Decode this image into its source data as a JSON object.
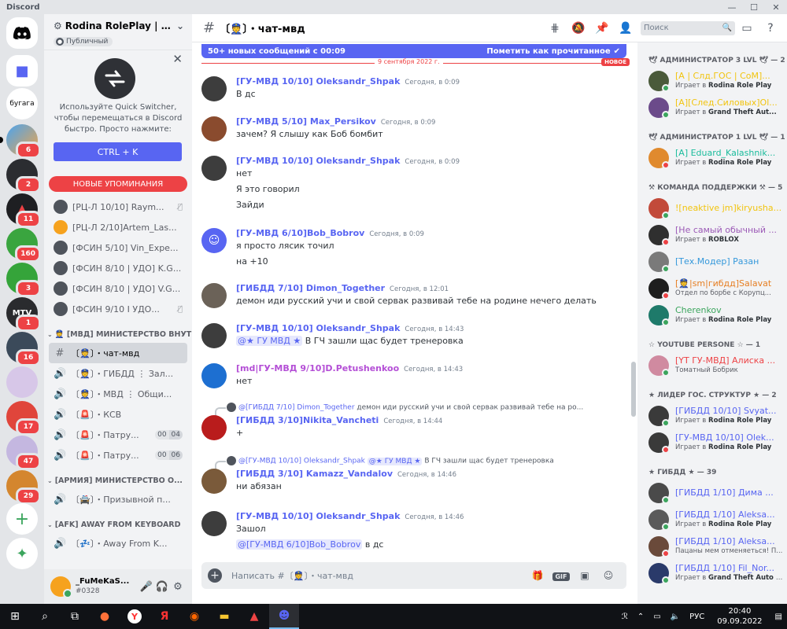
{
  "app": {
    "title": "Discord"
  },
  "colors": {
    "blurple": "#5865f2",
    "red": "#ed4245",
    "green": "#3ba55d"
  },
  "rail": {
    "servers": [
      {
        "name": "home",
        "label": ""
      },
      {
        "name": "folder",
        "label": ""
      },
      {
        "name": "bugaga",
        "label": "бугага"
      },
      {
        "name": "server-3",
        "badge": "6"
      },
      {
        "name": "server-4",
        "badge": "2"
      },
      {
        "name": "server-5",
        "badge": "11"
      },
      {
        "name": "server-6",
        "badge": "160"
      },
      {
        "name": "server-7",
        "badge": "3"
      },
      {
        "name": "server-8",
        "label": "MTV",
        "badge": "1"
      },
      {
        "name": "server-9",
        "badge": "16"
      },
      {
        "name": "server-10",
        "label": ""
      },
      {
        "name": "server-11",
        "badge": "17"
      },
      {
        "name": "server-12",
        "badge": "47"
      },
      {
        "name": "server-13",
        "badge": "29"
      }
    ]
  },
  "server": {
    "name": "Rodina RolePlay | Bo...",
    "public_label": "Публичный"
  },
  "quick_switcher": {
    "description": "Используйте Quick Switcher, чтобы перемещаться в Discord быстро. Просто нажмите:",
    "button": "CTRL + K"
  },
  "new_mentions": "НОВЫЕ УПОМИНАНИЯ",
  "channels": {
    "voice_users": [
      {
        "label": "[РЦ-Л 10/10] Raym..."
      },
      {
        "label": "[РЦ-Л 2/10]Artem_Las..."
      },
      {
        "label": "[ФСИН 5/10] Vin_Expe..."
      },
      {
        "label": "[ФСИН 8/10 | УДО] K.G..."
      },
      {
        "label": "[ФСИН 8/10 | УДО] V.G..."
      },
      {
        "label": "[ФСИН 9/10 I УДО..."
      }
    ],
    "category_mvd": "[МВД] МИНИСТЕРСТВО ВНУТ...",
    "mvd_channels": [
      {
        "label": "〔👮〕・чат-мвд",
        "count": []
      },
      {
        "label": "〔👮〕・ГИБДД ⋮ Зал...",
        "count": []
      },
      {
        "label": "〔👮〕・МВД ⋮ Общи...",
        "count": []
      },
      {
        "label": "〔🚨〕・КСВ",
        "count": []
      },
      {
        "label": "〔🚨〕・Патру...",
        "count": [
          "00",
          "04"
        ]
      },
      {
        "label": "〔🚨〕・Патру...",
        "count": [
          "00",
          "06"
        ]
      }
    ],
    "category_army": "[АРМИЯ] МИНИСТЕРСТВО О...",
    "army_channels": [
      {
        "label": "〔🚔〕・Призывной п..."
      }
    ],
    "category_afk": "[AFK] AWAY FROM KEYBOARD",
    "afk_channels": [
      {
        "label": "〔💤〕・Away From K..."
      }
    ]
  },
  "user": {
    "name": "_FuMeKaS...",
    "tag": "#0328"
  },
  "chat": {
    "channel_name": "〔👮〕・чат-мвд",
    "new_messages": "50+ новых сообщений с 00:09",
    "mark_read": "Пометить как прочитанное",
    "date_divider": "9 сентября 2022 г.",
    "new_badge": "НОВОЕ",
    "placeholder": "Написать #〔👮〕・чат-мвд",
    "messages": [
      {
        "author": "[ГУ-МВД 10/10] Oleksandr_Shpak",
        "time": "Сегодня, в 0:09",
        "lines": [
          "В дс"
        ]
      },
      {
        "author": "[ГУ-МВД 5/10] Max_Persikov",
        "time": "Сегодня, в 0:09",
        "lines": [
          "зачем? Я слышу как Боб бомбит"
        ]
      },
      {
        "author": "[ГУ-МВД 10/10] Oleksandr_Shpak",
        "time": "Сегодня, в 0:09",
        "lines": [
          "нет",
          "Я это говорил",
          "Зайди"
        ]
      },
      {
        "author": "[ГУ-МВД 6/10]Bob_Bobrov",
        "time": "Сегодня, в 0:09",
        "lines": [
          "я просто лясик точил",
          "на +10"
        ]
      },
      {
        "author": "[ГИБДД 7/10] Dimon_Together",
        "time": "Сегодня, в 12:01",
        "lines": [
          "демон иди русский учи и свой сервак развивай тебе на родине нечего делать"
        ]
      },
      {
        "author": "[ГУ-МВД 10/10] Oleksandr_Shpak",
        "time": "Сегодня, в 14:43",
        "mention": "@★ ГУ МВД ★",
        "lines": [
          "В ГЧ зашли щас будет тренеровка"
        ]
      },
      {
        "author": "[md|ГУ-МВД 9/10]D.Petushenkoo",
        "time": "Сегодня, в 14:43",
        "lines": [
          "нет"
        ]
      },
      {
        "reply_author": "@[ГИБДД 7/10] Dimon_Together",
        "reply_text": "демон иди русский учи и свой сервак развивай тебе на ро...",
        "author": "[ГИБДД 3/10]Nikita_Vancheti",
        "time": "Сегодня, в 14:44",
        "lines": [
          "+"
        ]
      },
      {
        "reply_author": "@[ГУ-МВД 10/10] Oleksandr_Shpak",
        "reply_mention": "@★ ГУ МВД ★",
        "reply_text": "В ГЧ зашли щас будет тренеровка",
        "author": "[ГИБДД 3/10] Kamazz_Vandalov",
        "time": "Сегодня, в 14:46",
        "lines": [
          "ни абязан"
        ]
      },
      {
        "author": "[ГУ-МВД 10/10] Oleksandr_Shpak",
        "time": "Сегодня, в 14:46",
        "lines": [
          "Зашол"
        ],
        "mention_line": "@[ГУ-МВД 6/10]Bob_Bobrov",
        "mention_tail": "в дс"
      }
    ]
  },
  "members_search": "Поиск",
  "members": {
    "groups": [
      {
        "title": "🕊 АДМИНИСТРАТОР 3 LVL 🕊 — 2",
        "items": [
          {
            "name": "[A | Слд.ГОС | СоМ]...",
            "color": "#f1c40f",
            "activity_prefix": "Играет в",
            "activity": "Rodina Role Play",
            "status": "online"
          },
          {
            "name": "[A][След.Силовых]Ol...",
            "color": "#f1c40f",
            "activity_prefix": "Играет в",
            "activity": "Grand Theft Aut...",
            "status": "online"
          }
        ]
      },
      {
        "title": "🕊 АДМИНИСТРАТОР 1 LVL 🕊 — 1",
        "items": [
          {
            "name": "[A] Eduard_Kalashnik...",
            "color": "#1abc9c",
            "activity_prefix": "Играет в",
            "activity": "Rodina Role Play",
            "status": "dnd"
          }
        ]
      },
      {
        "title": "⚒ КОМАНДА ПОДДЕРЖКИ ⚒ — 5",
        "items": [
          {
            "name": "![neaktive jm]kiryusha...",
            "color": "#f1c40f",
            "activity_prefix": "",
            "activity": "",
            "status": "online"
          },
          {
            "name": "[Не самый обычный ...",
            "color": "#9b59b6",
            "activity_prefix": "Играет в",
            "activity": "ROBLOX",
            "status": "dnd"
          },
          {
            "name": "[Тех.Модер] Разан",
            "color": "#3498db",
            "activity_prefix": "",
            "activity": "",
            "status": "online"
          },
          {
            "name": "[👮|sm|гибдд]Salavat",
            "color": "#e67e22",
            "activity_prefix": "",
            "activity": "Отдел по борбе с Корупц...",
            "status": "dnd"
          },
          {
            "name": "Cherenkov",
            "color": "#3ba55d",
            "activity_prefix": "Играет в",
            "activity": "Rodina Role Play",
            "status": "online"
          }
        ]
      },
      {
        "title": "☆ YOUTUBE PERSONE ☆ — 1",
        "items": [
          {
            "name": "[YT ГУ-МВД] Алиска ...",
            "color": "#ed4245",
            "activity_prefix": "",
            "activity": "Томатный Бобрик",
            "status": "online"
          }
        ]
      },
      {
        "title": "★ ЛИДЕР ГОС. СТРУКТУР ★ — 2",
        "items": [
          {
            "name": "[ГИБДД 10/10] Svyat...",
            "color": "#5865f2",
            "activity_prefix": "Играет в",
            "activity": "Rodina Role Play",
            "status": "online"
          },
          {
            "name": "[ГУ-МВД 10/10] Olek...",
            "color": "#5865f2",
            "activity_prefix": "Играет в",
            "activity": "Rodina Role Play",
            "status": "dnd"
          }
        ]
      },
      {
        "title": "★ ГИБДД ★ — 39",
        "items": [
          {
            "name": "[ГИБДД 1/10] Дима ...",
            "color": "#5865f2",
            "activity_prefix": "",
            "activity": "",
            "status": "online"
          },
          {
            "name": "[ГИБДД 1/10] Aleksa...",
            "color": "#5865f2",
            "activity_prefix": "Играет в",
            "activity": "Rodina Role Play",
            "status": "online"
          },
          {
            "name": "[ГИБДД 1/10] Aleksa...",
            "color": "#5865f2",
            "activity_prefix": "",
            "activity": "Пацаны мем отменяеться! П...",
            "status": "dnd"
          },
          {
            "name": "[ГИБДД 1/10] Fil_Nor...",
            "color": "#5865f2",
            "activity_prefix": "Играет в",
            "activity": "Grand Theft Auto Sa...",
            "status": "online"
          }
        ]
      }
    ]
  },
  "taskbar": {
    "lang": "РУС",
    "time": "20:40",
    "date": "09.09.2022"
  }
}
